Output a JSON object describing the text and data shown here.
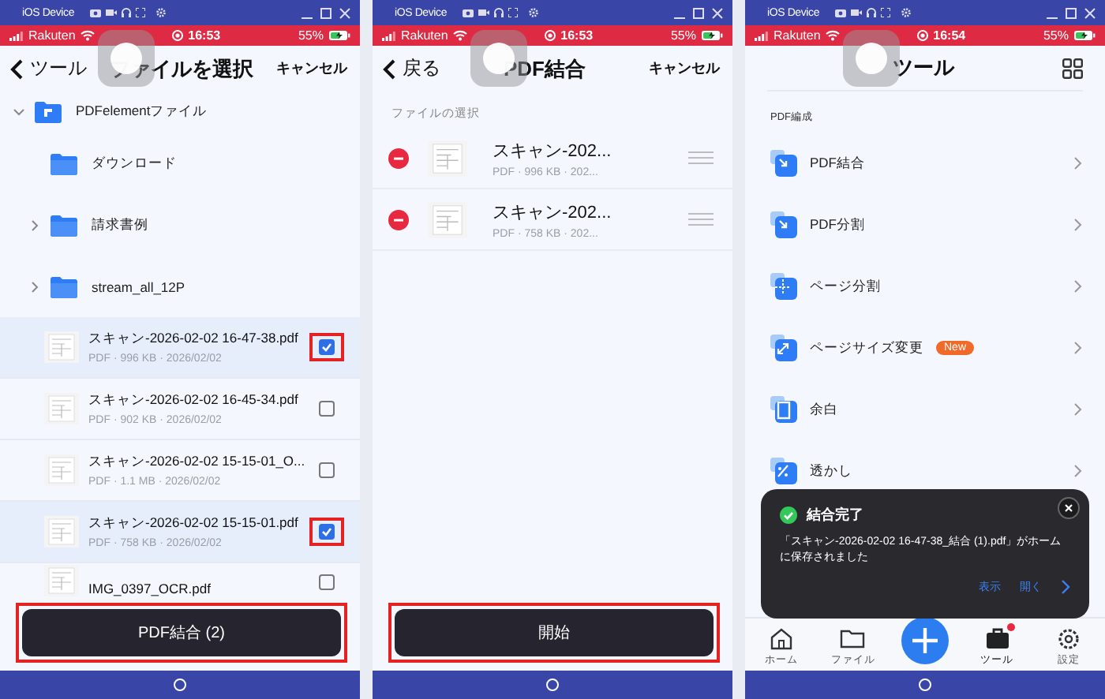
{
  "screens": [
    {
      "kind": "file_picker",
      "device": {
        "title": "iOS Device",
        "carrier": "Rakuten",
        "time": "16:53",
        "battery": "55%"
      },
      "nav": {
        "back": "ツール",
        "title": "ファイルを選択",
        "action": "キャンセル"
      },
      "tree": [
        {
          "label": "PDFelementファイル",
          "expanded": true,
          "children": [
            {
              "label": "ダウンロード"
            },
            {
              "label": "請求書例",
              "expanded": false
            },
            {
              "label": "stream_all_12P",
              "expanded": false
            }
          ]
        }
      ],
      "files": [
        {
          "name": "スキャン-2026-02-02 16-47-38.pdf",
          "meta": "PDF · 996 KB · 2026/02/02",
          "selected": true,
          "checked": true,
          "highlighted": true
        },
        {
          "name": "スキャン-2026-02-02 16-45-34.pdf",
          "meta": "PDF · 902 KB · 2026/02/02",
          "selected": false,
          "checked": false,
          "highlighted": false
        },
        {
          "name": "スキャン-2026-02-02 15-15-01_O...",
          "meta": "PDF · 1.1 MB · 2026/02/02",
          "selected": false,
          "checked": false,
          "highlighted": false
        },
        {
          "name": "スキャン-2026-02-02 15-15-01.pdf",
          "meta": "PDF · 758 KB · 2026/02/02",
          "selected": true,
          "checked": true,
          "highlighted": true
        },
        {
          "name": "IMG_0397_OCR.pdf",
          "selected": false,
          "checked": false,
          "highlighted": false
        }
      ],
      "button": {
        "label": "PDF結合 (2)",
        "highlighted": true
      }
    },
    {
      "kind": "merge",
      "device": {
        "title": "iOS Device",
        "carrier": "Rakuten",
        "time": "16:53",
        "battery": "55%"
      },
      "nav": {
        "back": "戻る",
        "title": "PDF結合",
        "action": "キャンセル"
      },
      "section": "ファイルの選択",
      "files": [
        {
          "name": "スキャン-202...",
          "meta": "PDF · 996 KB · 202..."
        },
        {
          "name": "スキャン-202...",
          "meta": "PDF · 758 KB · 202..."
        }
      ],
      "button": {
        "label": "開始",
        "highlighted": true
      }
    },
    {
      "kind": "tools",
      "device": {
        "title": "iOS Device",
        "carrier": "Rakuten",
        "time": "16:54",
        "battery": "55%"
      },
      "nav": {
        "title": "ツール"
      },
      "section": "PDF編成",
      "tools": [
        {
          "label": "PDF結合"
        },
        {
          "label": "PDF分割"
        },
        {
          "label": "ページ分割"
        },
        {
          "label": "ページサイズ変更",
          "badge": "New"
        },
        {
          "label": "余白"
        },
        {
          "label": "透かし"
        }
      ],
      "toast": {
        "title": "結合完了",
        "message": "「スキャン-2026-02-02 16-47-38_結合 (1).pdf」がホームに保存されました",
        "actions": [
          "表示",
          "開く"
        ]
      },
      "tabs": [
        {
          "kind": "tab",
          "label": "ホーム",
          "selected": false,
          "notification": false
        },
        {
          "kind": "tab",
          "label": "ファイル",
          "selected": false,
          "notification": false
        },
        {
          "kind": "add"
        },
        {
          "kind": "tab",
          "label": "ツール",
          "selected": true,
          "notification": true
        },
        {
          "kind": "tab",
          "label": "設定",
          "selected": false,
          "notification": false
        }
      ]
    }
  ]
}
